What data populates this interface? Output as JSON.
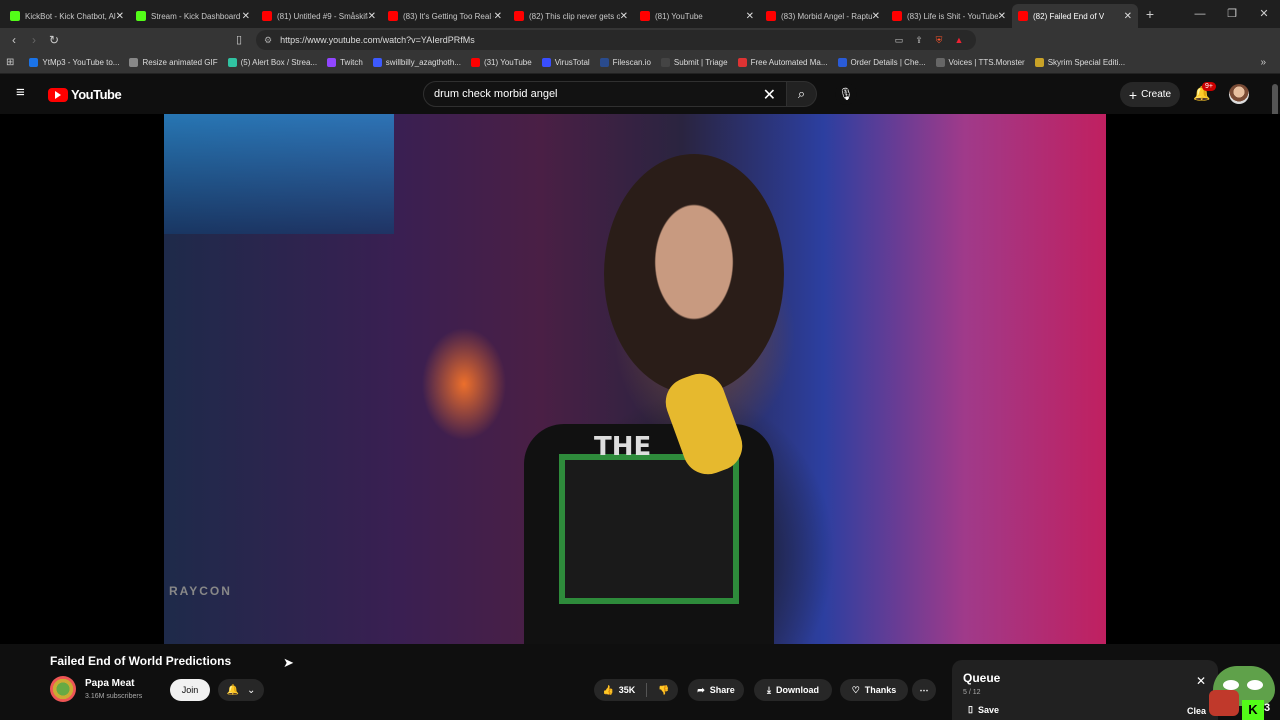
{
  "browser": {
    "tabs": [
      {
        "title": "KickBot - Kick Chatbot, Ale",
        "color": "#53fc18"
      },
      {
        "title": "Stream - Kick Dashboard",
        "color": "#53fc18"
      },
      {
        "title": "(81) Untitled #9 - Småskifa",
        "color": "#ff0000"
      },
      {
        "title": "(83) It's Getting Too Real -",
        "color": "#ff0000"
      },
      {
        "title": "(82) This clip never gets ol",
        "color": "#ff0000"
      },
      {
        "title": "(81) YouTube",
        "color": "#ff0000"
      },
      {
        "title": "(83) Morbid Angel - Raptu",
        "color": "#ff0000"
      },
      {
        "title": "(83) Life is Shit - YouTube",
        "color": "#ff0000"
      },
      {
        "title": "(82) Failed End of V",
        "color": "#ff0000",
        "active": true
      }
    ],
    "url": "https://www.youtube.com/watch?v=YAIerdPRfMs",
    "bookmarks": [
      {
        "label": "YtMp3 - YouTube to...",
        "color": "#1a73e8"
      },
      {
        "label": "Resize animated GIF",
        "color": "#888888"
      },
      {
        "label": "(5) Alert Box / Strea...",
        "color": "#31c3a2"
      },
      {
        "label": "Twitch",
        "color": "#9146ff"
      },
      {
        "label": "swillbilly_azagthoth...",
        "color": "#3d5afe"
      },
      {
        "label": "(31) YouTube",
        "color": "#ff0000"
      },
      {
        "label": "VirusTotal",
        "color": "#394eff"
      },
      {
        "label": "Filescan.io",
        "color": "#2a4b8d"
      },
      {
        "label": "Submit | Triage",
        "color": "#444444"
      },
      {
        "label": "Free Automated Ma...",
        "color": "#d33"
      },
      {
        "label": "Order Details | Che...",
        "color": "#2a5bd7"
      },
      {
        "label": "Voices | TTS.Monster",
        "color": "#666666"
      },
      {
        "label": "Skyrim Special Editi...",
        "color": "#c9a227"
      }
    ]
  },
  "youtube": {
    "logo_text": "YouTube",
    "search_value": "drum check morbid angel",
    "create_label": "Create",
    "notifications_badge": "9+"
  },
  "video": {
    "shirt_text": "THE",
    "sticker_text": "RAYCON",
    "title": "Failed End of World Predictions",
    "channel_name": "Papa Meat",
    "subscribers": "3.16M subscribers",
    "join_label": "Join",
    "like_count": "35K",
    "share_label": "Share",
    "download_label": "Download",
    "thanks_label": "Thanks"
  },
  "queue": {
    "title": "Queue",
    "position": "5 / 12",
    "save_label": "Save",
    "clear_label": "Clea"
  },
  "overlay": {
    "kick_count": "3"
  }
}
